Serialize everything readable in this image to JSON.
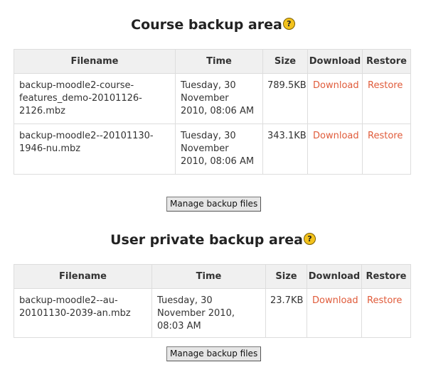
{
  "course_section": {
    "title": "Course backup area",
    "headers": {
      "filename": "Filename",
      "time": "Time",
      "size": "Size",
      "download": "Download",
      "restore": "Restore"
    },
    "rows": [
      {
        "filename": "backup-moodle2-course-features_demo-20101126-2126.mbz",
        "time": "Tuesday, 30 November 2010, 08:06 AM",
        "size": "789.5KB",
        "download": "Download",
        "restore": "Restore"
      },
      {
        "filename": "backup-moodle2--20101130-1946-nu.mbz",
        "time": "Tuesday, 30 November 2010, 08:06 AM",
        "size": "343.1KB",
        "download": "Download",
        "restore": "Restore"
      }
    ],
    "manage_button": "Manage backup files"
  },
  "user_section": {
    "title": "User private backup area",
    "headers": {
      "filename": "Filename",
      "time": "Time",
      "size": "Size",
      "download": "Download",
      "restore": "Restore"
    },
    "rows": [
      {
        "filename": "backup-moodle2--au-20101130-2039-an.mbz",
        "time": "Tuesday, 30 November 2010, 08:03 AM",
        "size": "23.7KB",
        "download": "Download",
        "restore": "Restore"
      }
    ],
    "manage_button": "Manage backup files"
  },
  "icons": {
    "help": "help-icon"
  },
  "colors": {
    "link": "#e05b3a",
    "header_bg": "#f0f0f0",
    "border": "#dddddd"
  }
}
